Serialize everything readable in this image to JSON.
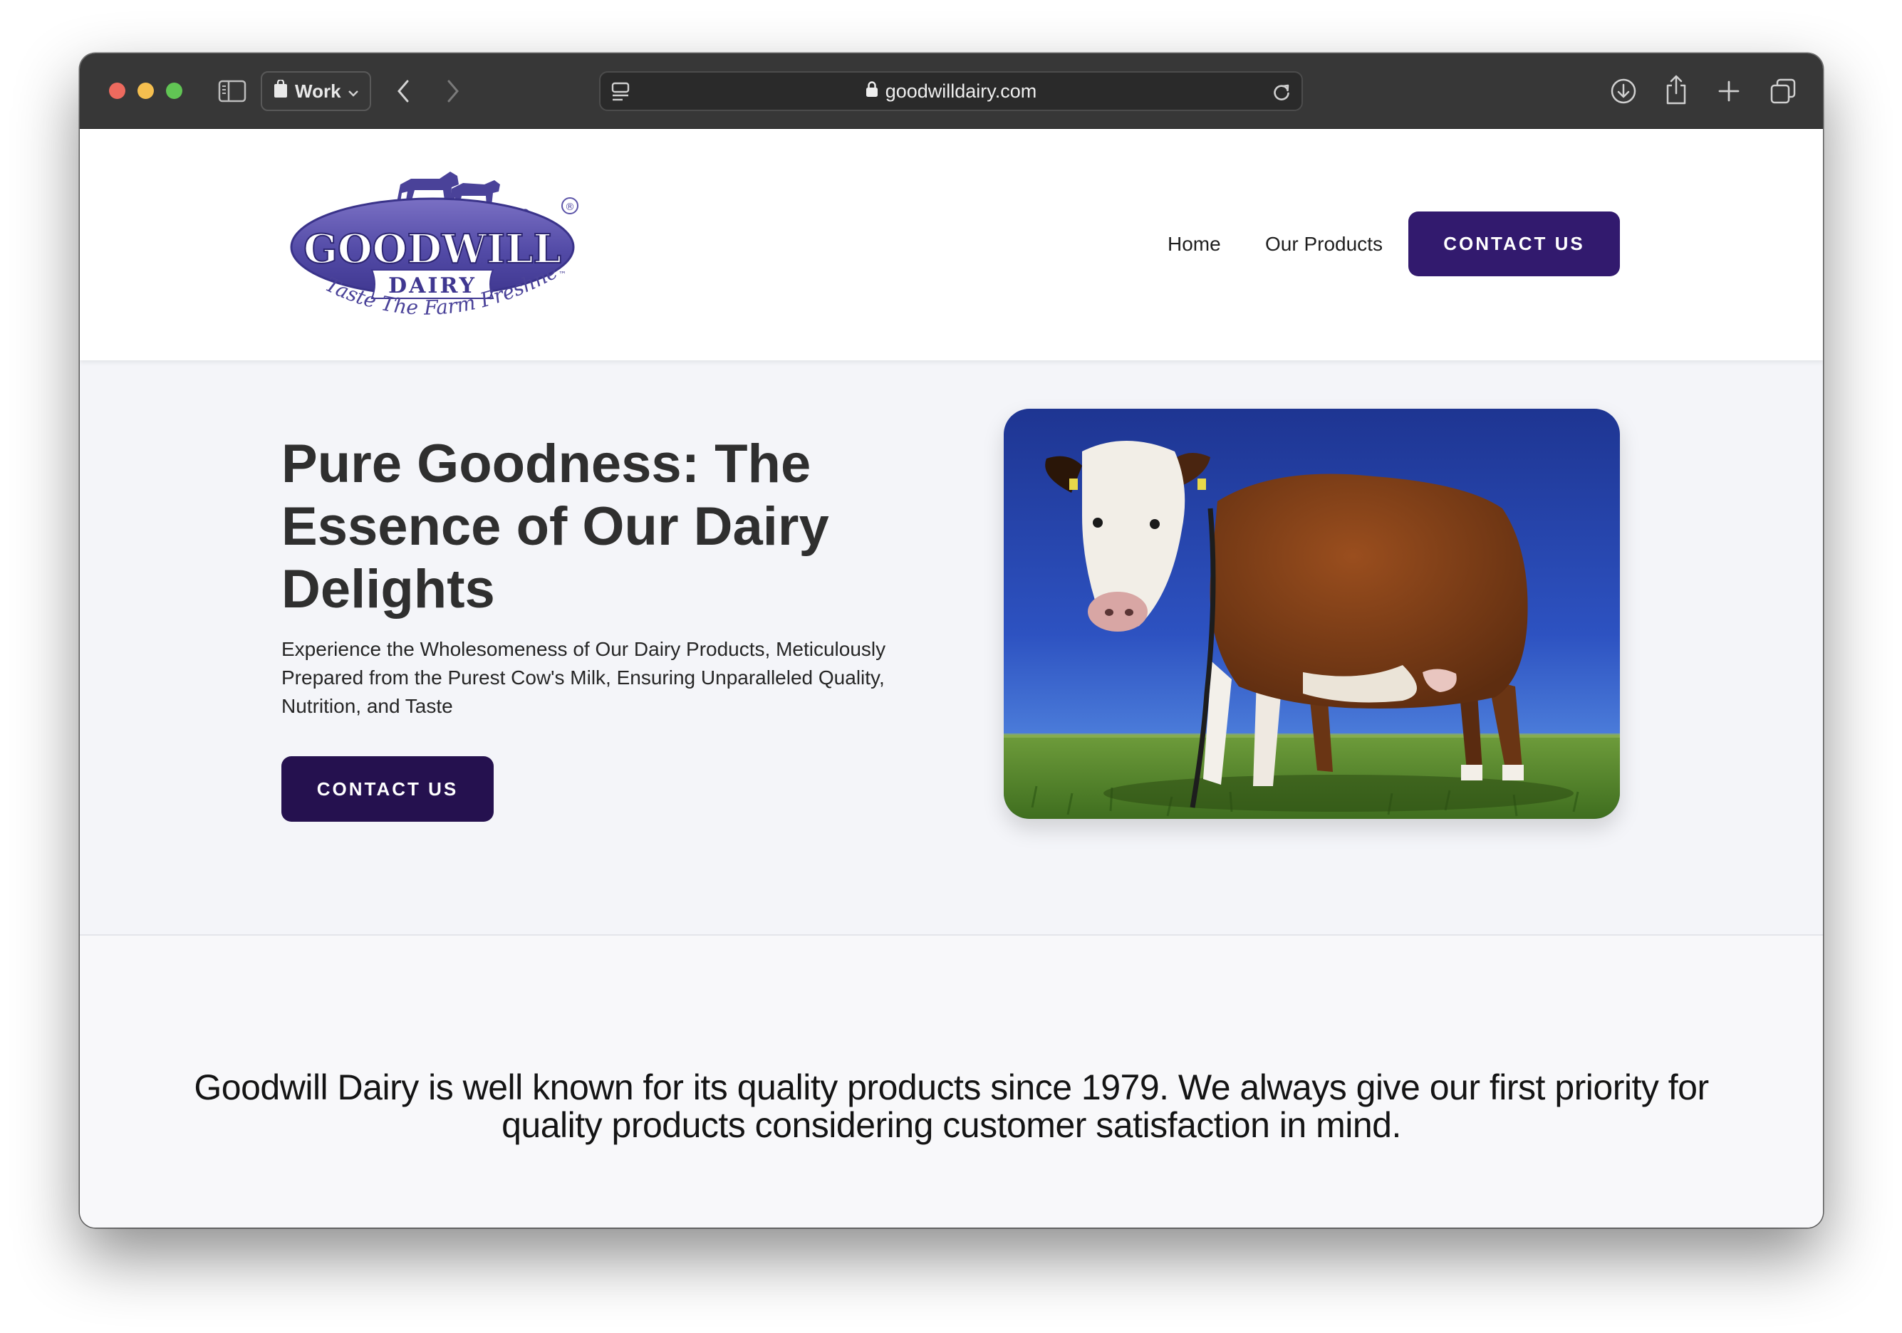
{
  "browser": {
    "tab_group_label": "Work",
    "url": "goodwilldairy.com"
  },
  "site": {
    "logo": {
      "brand": "GOODWILL",
      "sub": "DAIRY",
      "tagline": "Taste The Farm Freshness",
      "tagline_mark": "™",
      "registered_mark": "®"
    },
    "nav": {
      "home": "Home",
      "products": "Our Products",
      "contact": "CONTACT US"
    }
  },
  "hero": {
    "title": "Pure Goodness: The Essence of Our Dairy Delights",
    "subtitle": "Experience the Wholesomeness of Our Dairy Products, Meticulously Prepared from the Purest Cow's Milk, Ensuring Unparalleled Quality, Nutrition, and Taste",
    "cta": "CONTACT US"
  },
  "about": {
    "text": "Goodwill Dairy is well known for its quality products since 1979. We always give our first priority for quality products considering customer satisfaction in mind."
  },
  "colors": {
    "brand_purple": "#321a6e",
    "hero_button": "#25114f",
    "toolbar": "#373737"
  }
}
